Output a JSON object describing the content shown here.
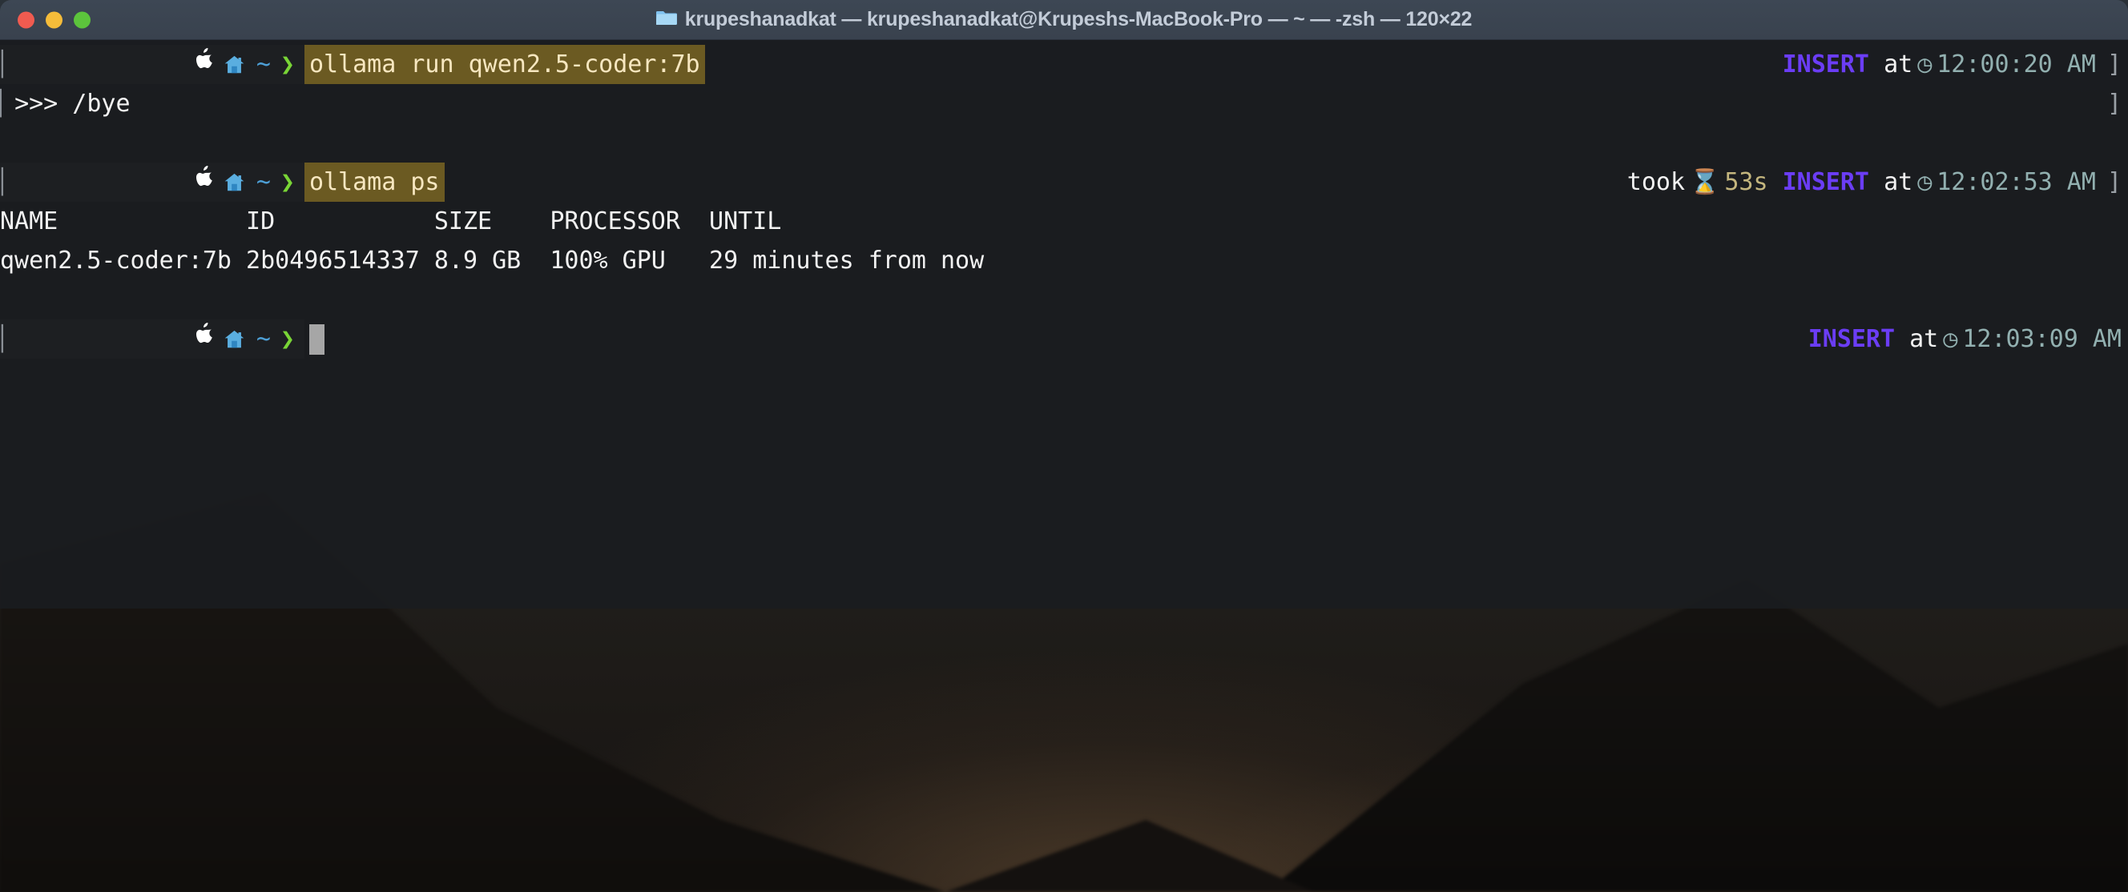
{
  "window": {
    "title": "krupeshanadkat — krupeshanadkat@Krupeshs-MacBook-Pro — ~ — -zsh — 120×22",
    "folder_icon": "folder-icon",
    "traffic_lights": {
      "close": "close-button",
      "minimize": "minimize-button",
      "maximize": "maximize-button"
    },
    "colors": {
      "titlebar": "#3d4754",
      "title_text": "#c3ccd8",
      "close": "#f05b50",
      "minimize": "#f5bc3a",
      "maximize": "#5cc43c",
      "terminal_bg": "#1a1c1f",
      "highlight_bg": "#6b5a22",
      "highlight_fg": "#f7e7c0",
      "insert_mode": "#6b3df5",
      "clock": "#92b0b0",
      "duration": "#c4b67e",
      "prompt_chevron": "#79d536",
      "prompt_tilde": "#4d9fd6",
      "cursor": "#a6a6a6"
    }
  },
  "prompt": {
    "edge_bar": "▏",
    "apple_glyph": "",
    "home_icon": "house-icon",
    "path": "~",
    "chevron": "❯"
  },
  "lines": [
    {
      "id": "line-1",
      "type": "command",
      "command": "ollama run qwen2.5-coder:7b",
      "status": {
        "took_label": "",
        "duration": "",
        "mode": "INSERT",
        "at_label": "at",
        "clock_glyph": "◷",
        "time": "12:00:20 AM"
      },
      "marker": "]"
    },
    {
      "id": "line-2",
      "type": "output",
      "text": ">>> /bye",
      "marker": "]"
    },
    {
      "id": "line-3",
      "type": "blank",
      "text": ""
    },
    {
      "id": "line-4",
      "type": "command",
      "command": "ollama ps",
      "status": {
        "took_label": "took",
        "hourglass_glyph": "⌛",
        "duration": "53s",
        "mode": "INSERT",
        "at_label": "at",
        "clock_glyph": "◷",
        "time": "12:02:53 AM"
      },
      "marker": "]"
    },
    {
      "id": "line-7",
      "type": "prompt",
      "command": "",
      "status": {
        "mode": "INSERT",
        "at_label": "at",
        "clock_glyph": "◷",
        "time": "12:03:09 AM"
      }
    }
  ],
  "ps_table": {
    "headers": [
      "NAME",
      "ID",
      "SIZE",
      "PROCESSOR",
      "UNTIL"
    ],
    "col_starts": [
      0,
      17,
      30,
      38,
      49
    ],
    "rows": [
      {
        "NAME": "qwen2.5-coder:7b",
        "ID": "2b0496514337",
        "SIZE": "8.9 GB",
        "PROCESSOR": "100% GPU",
        "UNTIL": "29 minutes from now"
      }
    ]
  }
}
